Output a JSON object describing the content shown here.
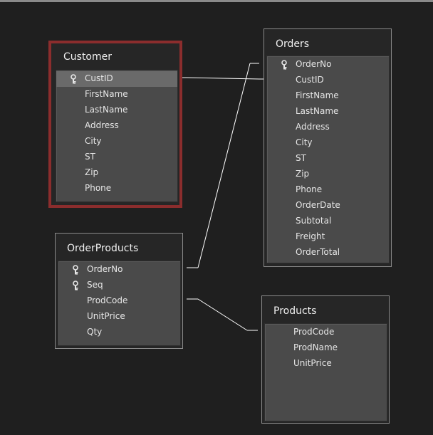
{
  "tables": {
    "customer": {
      "title": "Customer",
      "fields": [
        "CustID",
        "FirstName",
        "LastName",
        "Address",
        "City",
        "ST",
        "Zip",
        "Phone"
      ],
      "keys": [
        0
      ],
      "highlighted": [
        0
      ],
      "selected": true
    },
    "orders": {
      "title": "Orders",
      "fields": [
        "OrderNo",
        "CustID",
        "FirstName",
        "LastName",
        "Address",
        "City",
        "ST",
        "Zip",
        "Phone",
        "OrderDate",
        "Subtotal",
        "Freight",
        "OrderTotal"
      ],
      "keys": [
        0
      ]
    },
    "orderproducts": {
      "title": "OrderProducts",
      "fields": [
        "OrderNo",
        "Seq",
        "ProdCode",
        "UnitPrice",
        "Qty"
      ],
      "keys": [
        0,
        1
      ]
    },
    "products": {
      "title": "Products",
      "fields": [
        "ProdCode",
        "ProdName",
        "UnitPrice"
      ],
      "keys": []
    }
  },
  "relationships": [
    {
      "from": "Customer.CustID",
      "to": "Orders.CustID"
    },
    {
      "from": "OrderProducts.OrderNo",
      "to": "Orders.OrderNo"
    },
    {
      "from": "OrderProducts.ProdCode",
      "to": "Products.ProdCode"
    }
  ],
  "colors": {
    "background": "#1f1f1f",
    "selection_border": "#8b2d2d",
    "field_highlight": "#6a6a6a",
    "line": "#ffffff"
  },
  "icons": {
    "primary_key": "key-icon"
  }
}
